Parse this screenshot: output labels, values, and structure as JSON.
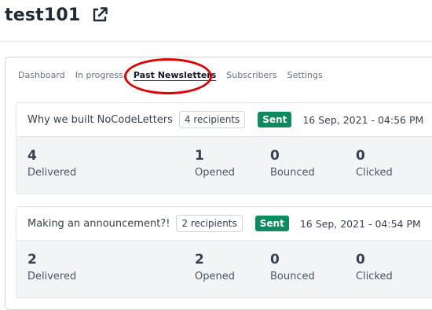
{
  "header": {
    "title": "test101",
    "external_link_icon": "external-link-icon"
  },
  "tabs": [
    {
      "label": "Dashboard",
      "active": false
    },
    {
      "label": "In progress",
      "active": false
    },
    {
      "label": "Past Newsletters",
      "active": true
    },
    {
      "label": "Subscribers",
      "active": false
    },
    {
      "label": "Settings",
      "active": false
    }
  ],
  "annotation": {
    "color": "#e10000"
  },
  "newsletters": [
    {
      "subject": "Why we built NoCodeLetters",
      "recipients": "4 recipients",
      "status": "Sent",
      "date": "16 Sep, 2021 - 04:56 PM",
      "stats": [
        {
          "value": "4",
          "label": "Delivered"
        },
        {
          "value": "1",
          "label": "Opened"
        },
        {
          "value": "0",
          "label": "Bounced"
        },
        {
          "value": "0",
          "label": "Clicked"
        }
      ]
    },
    {
      "subject": "Making an announcement?!",
      "recipients": "2 recipients",
      "status": "Sent",
      "date": "16 Sep, 2021 - 04:54 PM",
      "stats": [
        {
          "value": "2",
          "label": "Delivered"
        },
        {
          "value": "2",
          "label": "Opened"
        },
        {
          "value": "0",
          "label": "Bounced"
        },
        {
          "value": "0",
          "label": "Clicked"
        }
      ]
    }
  ],
  "colors": {
    "sent_badge": "#0e8a5f",
    "stats_bg": "#f3f4f6",
    "title": "#1f2937"
  }
}
